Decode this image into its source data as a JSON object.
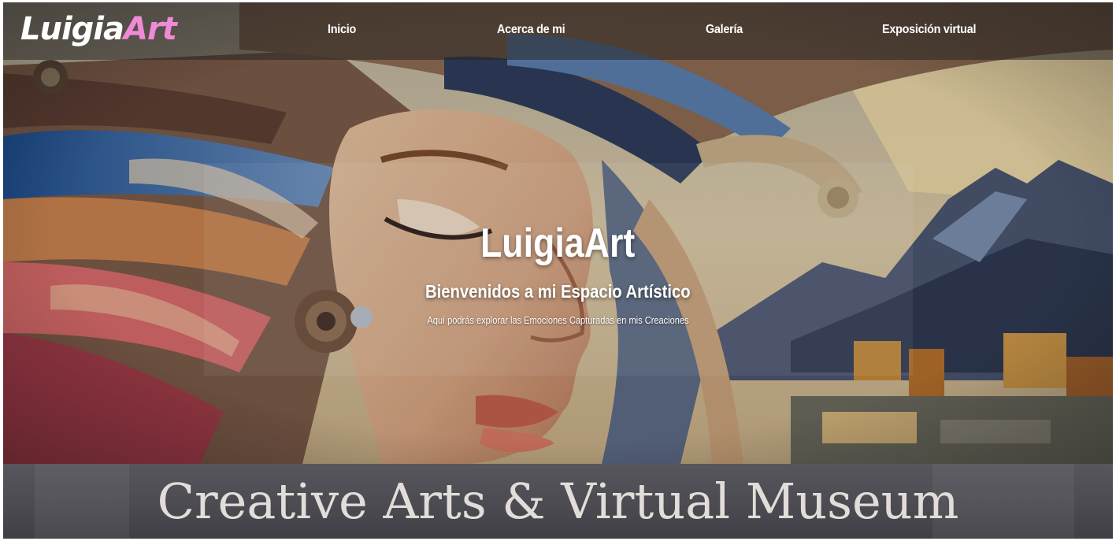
{
  "nav": {
    "logo_part1": "Luigia",
    "logo_part2": "Art",
    "links": [
      {
        "label": "Inicio"
      },
      {
        "label": "Acerca de mi"
      },
      {
        "label": "Galería"
      },
      {
        "label": "Exposición virtual"
      }
    ]
  },
  "hero": {
    "title": "LuigiaArt",
    "subtitle": "Bienvenidos a mi Espacio Artístico",
    "description": "Aquí podrás explorar las Emociones Capturadas en mis Creaciones"
  },
  "banner": {
    "text": "Creative Arts & Virtual Museum"
  },
  "colors": {
    "logo_accent": "#f08ad6",
    "banner_bg": "#4a4a50",
    "banner_text": "#e2ddd9"
  }
}
